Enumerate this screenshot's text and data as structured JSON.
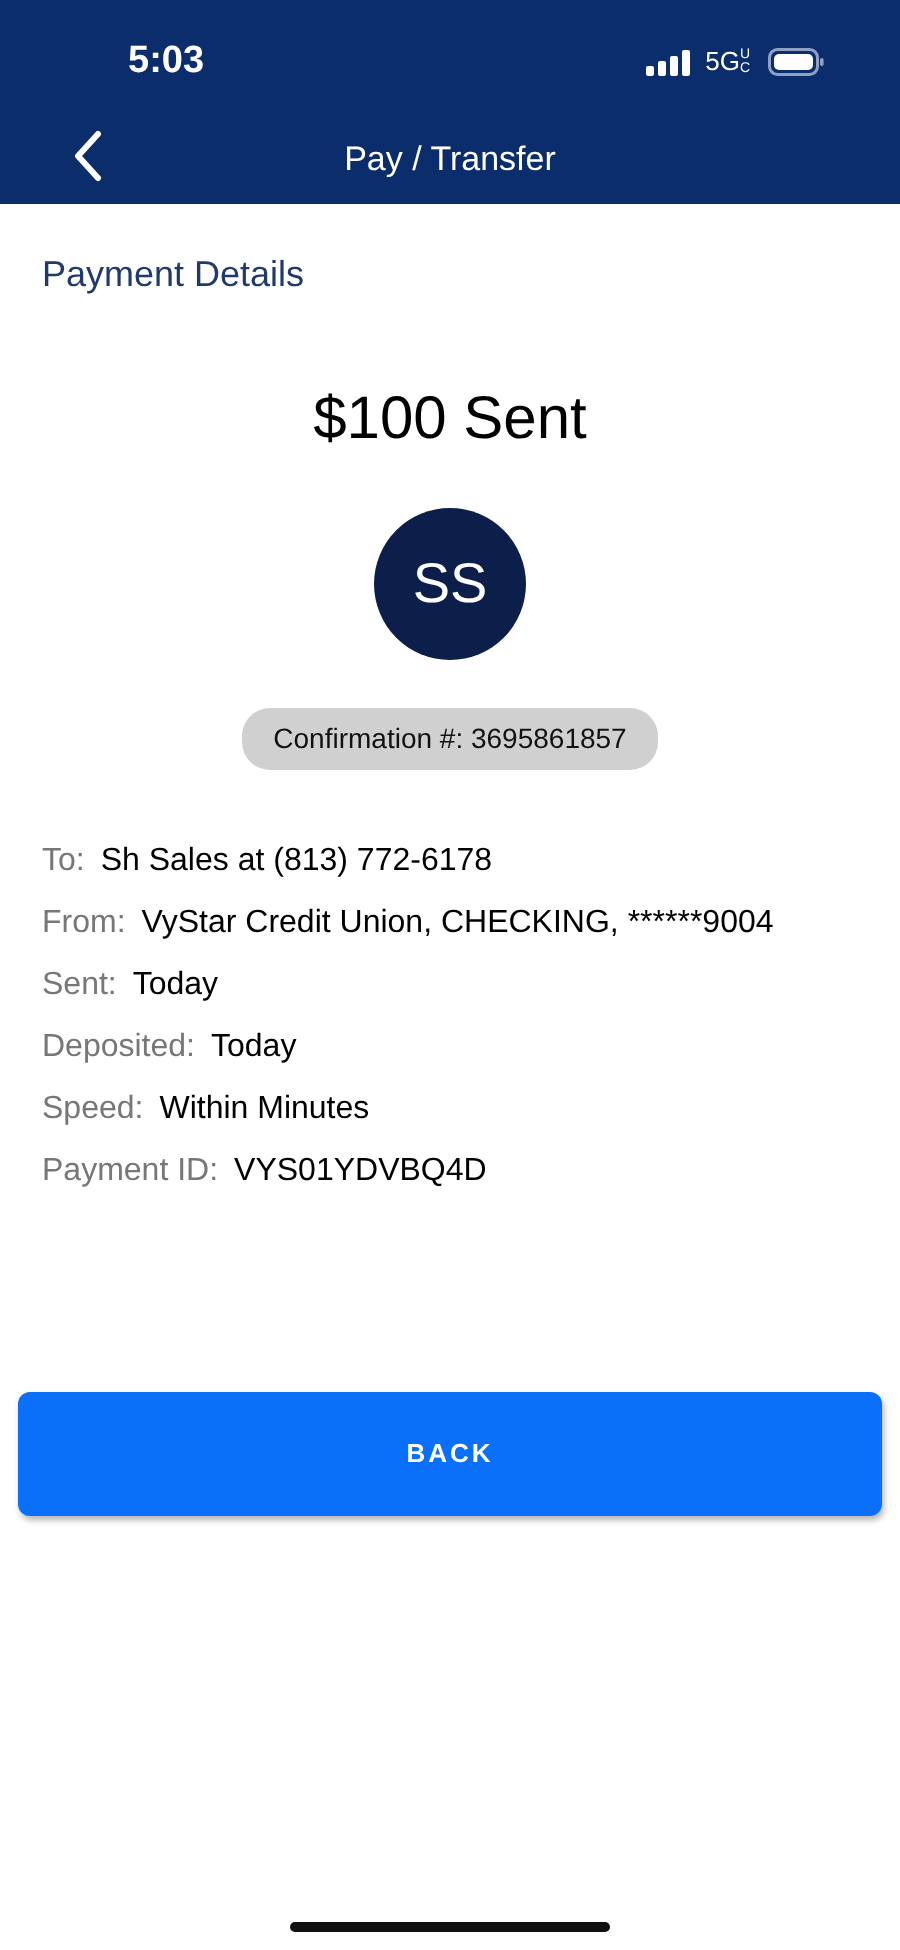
{
  "status_bar": {
    "time": "5:03",
    "network": "5G",
    "network_sub": "UC"
  },
  "header": {
    "title": "Pay / Transfer"
  },
  "section_title": "Payment Details",
  "amount": "$100 Sent",
  "avatar": {
    "initials": "SS"
  },
  "confirmation": "Confirmation #: 3695861857",
  "details": [
    {
      "label": "To:",
      "value": "Sh Sales at (813) 772-6178"
    },
    {
      "label": "From:",
      "value": "VyStar Credit Union, CHECKING, ******9004"
    },
    {
      "label": "Sent:",
      "value": "Today"
    },
    {
      "label": "Deposited:",
      "value": "Today"
    },
    {
      "label": "Speed:",
      "value": "Within Minutes"
    },
    {
      "label": "Payment ID:",
      "value": "VYS01YDVBQ4D"
    }
  ],
  "button": "BACK"
}
